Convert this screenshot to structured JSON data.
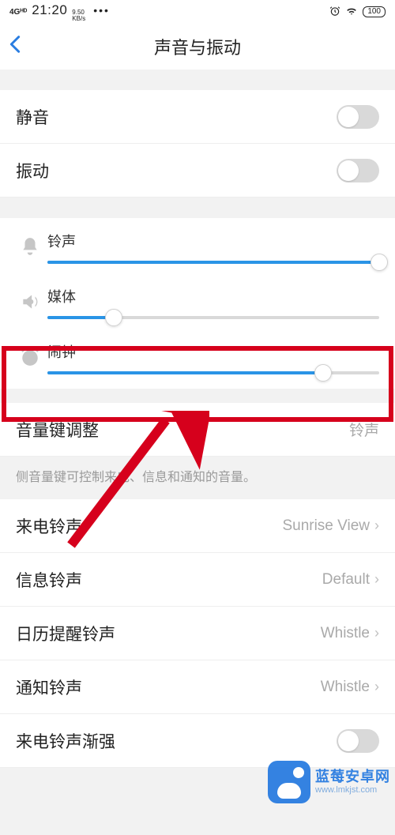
{
  "status": {
    "network": "4Gᴴᴰ",
    "time": "21:20",
    "kb_top": "9.50",
    "kb_bot": "KB/s",
    "battery": "100"
  },
  "header": {
    "title": "声音与振动"
  },
  "toggles": {
    "mute_label": "静音",
    "vibrate_label": "振动"
  },
  "sliders": {
    "ringtone": {
      "label": "铃声",
      "pct": 100
    },
    "media": {
      "label": "媒体",
      "pct": 20
    },
    "alarm": {
      "label": "闹钟",
      "pct": 83
    }
  },
  "volume_key": {
    "label": "音量键调整",
    "value": "铃声",
    "desc": "侧音量键可控制来电、信息和通知的音量。"
  },
  "ringtones": {
    "incoming": {
      "label": "来电铃声",
      "value": "Sunrise View"
    },
    "message": {
      "label": "信息铃声",
      "value": "Default"
    },
    "calendar": {
      "label": "日历提醒铃声",
      "value": "Whistle"
    },
    "notify": {
      "label": "通知铃声",
      "value": "Whistle"
    },
    "crescendo": {
      "label": "来电铃声渐强"
    }
  },
  "watermark": {
    "line1": "蓝莓安卓网",
    "line2": "www.lmkjst.com"
  }
}
